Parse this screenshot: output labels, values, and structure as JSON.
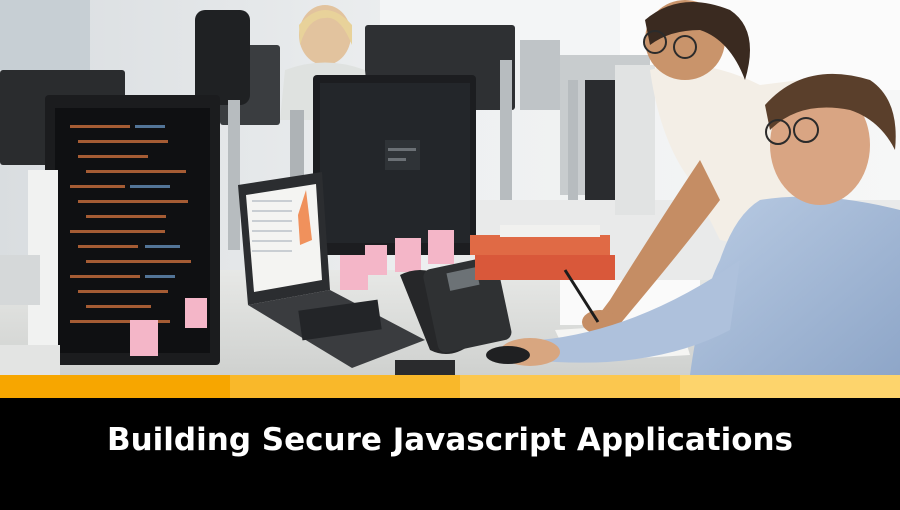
{
  "banner": {
    "title": "Building Secure Javascript Applications",
    "image_subject": "office-team-at-computer-monitors"
  },
  "colors": {
    "title_bar": "#000000",
    "title_text": "#ffffff",
    "stripe": [
      "#f7a600",
      "#f9b82a",
      "#fbc74f",
      "#fdd46c"
    ]
  },
  "icons": {
    "code_monitor": "monitor-icon",
    "laptop": "laptop-icon",
    "desk_phone": "phone-icon"
  }
}
